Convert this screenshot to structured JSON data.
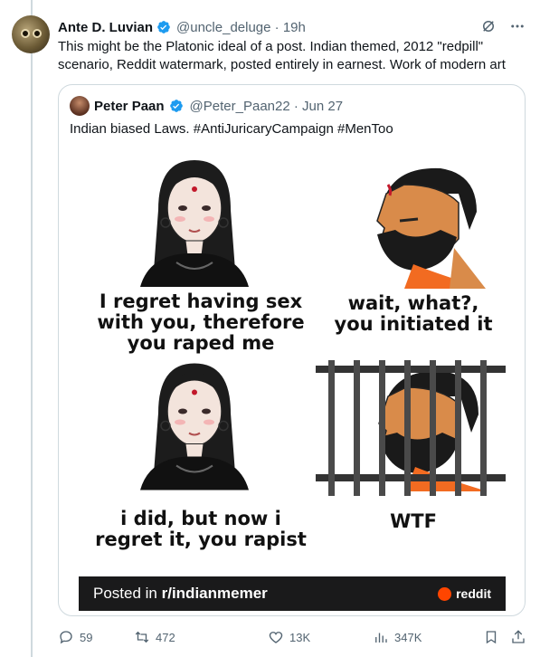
{
  "post": {
    "author_name": "Ante D. Luvian",
    "handle_time": "@uncle_deluge · 19h",
    "text": "This might be the Platonic ideal of a post. Indian themed, 2012 \"redpill\" scenario, Reddit watermark, posted entirely in earnest. Work of modern art"
  },
  "quote": {
    "author_name": "Peter Paan",
    "handle_time": "@Peter_Paan22 · Jun 27",
    "text": "Indian biased Laws. #AntiJuricaryCampaign #MenToo",
    "meme": {
      "caption_1": "I regret having sex with you, therefore you raped me",
      "caption_1_lines": [
        "I regret having sex",
        "with you, therefore",
        "you raped me"
      ],
      "caption_2_lines": [
        "wait, what?,",
        "you initiated it"
      ],
      "caption_3_lines": [
        "i did, but now i",
        "regret it, you rapist"
      ],
      "caption_4": "WTF",
      "posted_in": "Posted in ",
      "subreddit": "r/indianmemer",
      "reddit_logo_text": "reddit"
    }
  },
  "actions": {
    "replies": "59",
    "reposts": "472",
    "likes": "13K",
    "views": "347K"
  },
  "icons": [
    "verified-badge-icon",
    "grok-icon",
    "more-icon",
    "reply-icon",
    "retweet-icon",
    "like-icon",
    "views-icon",
    "bookmark-icon",
    "share-icon"
  ],
  "colors": {
    "verified": "#1d9bf0",
    "secondary_text": "#536471",
    "border": "#cfd9de",
    "reddit_orange": "#ff4500"
  }
}
